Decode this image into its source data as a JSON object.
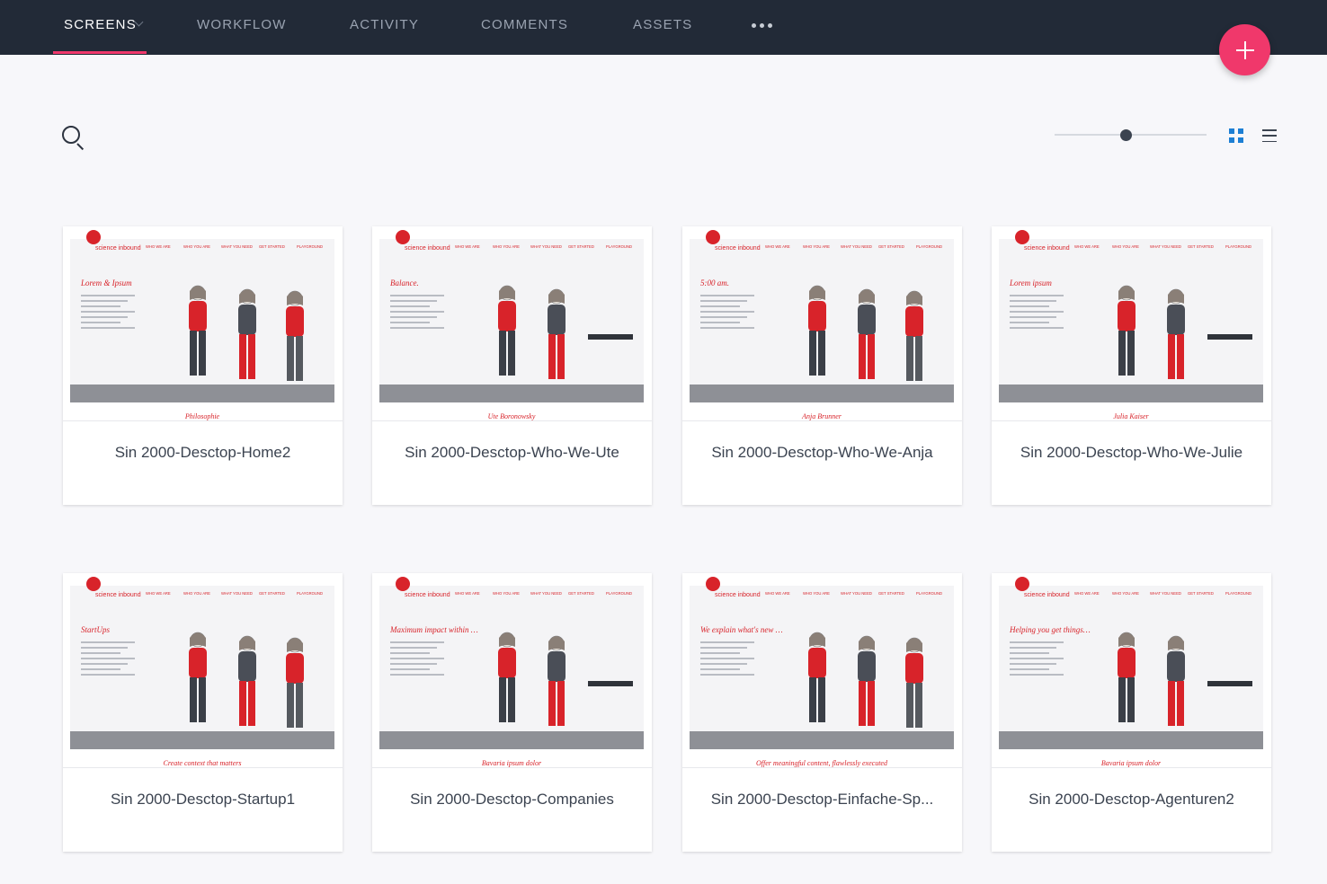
{
  "nav": {
    "tabs": [
      {
        "label": "SCREENS"
      },
      {
        "label": "WORKFLOW"
      },
      {
        "label": "ACTIVITY"
      },
      {
        "label": "COMMENTS"
      },
      {
        "label": "ASSETS"
      }
    ],
    "active_tab": "SCREENS",
    "more_icon": "ellipsis-icon",
    "add_icon": "plus-icon"
  },
  "toolbar": {
    "search_icon": "search-icon",
    "zoom_level": 0.47,
    "view_modes": [
      "grid-view",
      "list-view"
    ],
    "active_view": "grid-view"
  },
  "colors": {
    "nav_bg": "#222a37",
    "accent": "#f0386b",
    "grid_active": "#1d7fd4",
    "brand_red": "#d8232a"
  },
  "screens": [
    {
      "title": "Sin 2000-Desctop-Home2",
      "caption": "Philosophie",
      "heading": "Lorem & Ipsum"
    },
    {
      "title": "Sin 2000-Desctop-Who-We-Ute",
      "caption": "Ute Boronowsky",
      "heading": "Balance."
    },
    {
      "title": "Sin 2000-Desctop-Who-We-Anja",
      "caption": "Anja Brunner",
      "heading": "5:00 am."
    },
    {
      "title": "Sin 2000-Desctop-Who-We-Julie",
      "caption": "Julia Kaiser",
      "heading": "Lorem ipsum"
    },
    {
      "title": "Sin 2000-Desctop-Startup1",
      "caption": "Create context that matters",
      "heading": "StartUps"
    },
    {
      "title": "Sin 2000-Desctop-Companies",
      "caption": "Bavaria ipsum dolor",
      "heading": "Maximum impact within your bounds"
    },
    {
      "title": "Sin 2000-Desctop-Einfache-Sp...",
      "caption": "Offer meaningful content, flawlessly executed",
      "heading": "We explain what's new in science – and what it means to you."
    },
    {
      "title": "Sin 2000-Desctop-Agenturen2",
      "caption": "Bavaria ipsum dolor",
      "heading": "Helping you get things done"
    }
  ],
  "thumb_nav": [
    "WHO WE ARE",
    "WHO YOU ARE",
    "WHAT YOU NEED",
    "GET STARTED",
    "PLAYGROUND"
  ],
  "thumb_logo": "science inbound"
}
